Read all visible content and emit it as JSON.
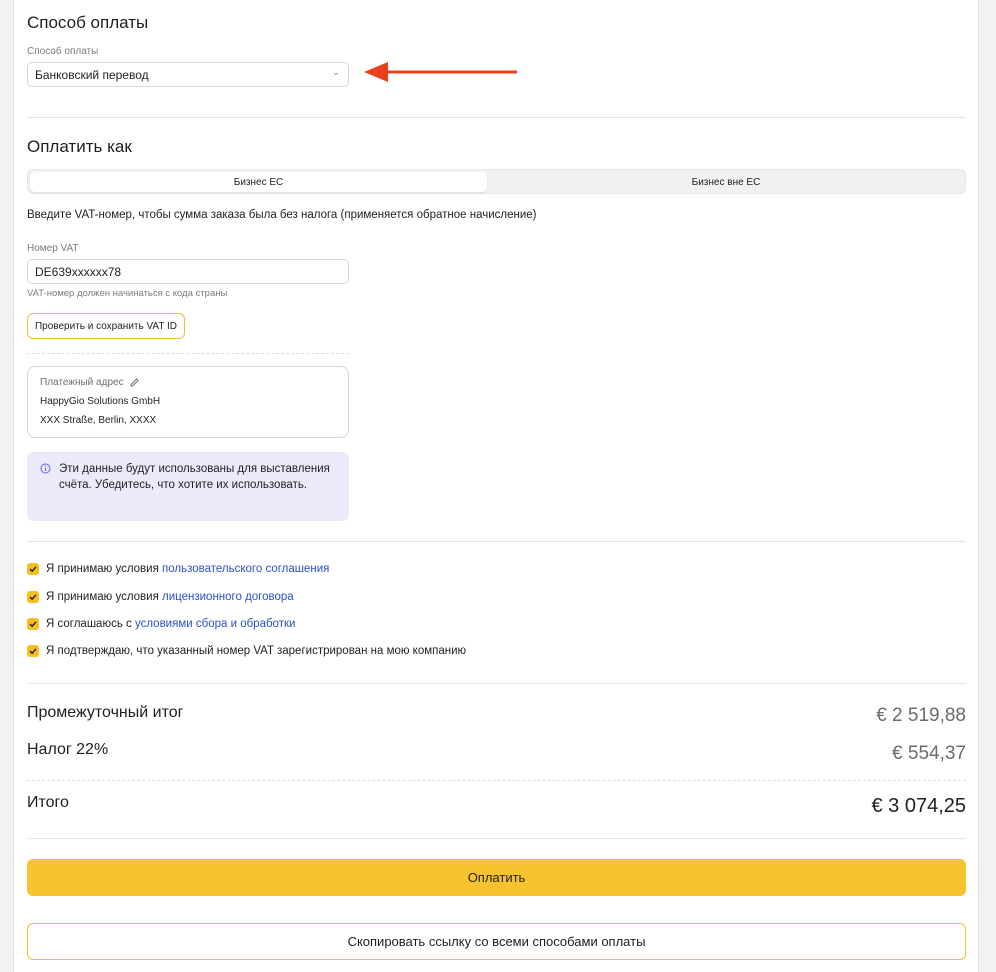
{
  "payment_method": {
    "title": "Способ оплаты",
    "field_label": "Способ оплаты",
    "selected": "Банковский перевод"
  },
  "pay_as": {
    "title": "Оплатить как",
    "tabs": [
      {
        "label": "Бизнес ЕС",
        "active": true
      },
      {
        "label": "Бизнес вне ЕС",
        "active": false
      }
    ],
    "description": "Введите VAT-номер, чтобы сумма заказа была без налога (применяется обратное начисление)",
    "vat_label": "Номер VAT",
    "vat_value": "DE639xxxxxx78",
    "vat_hint": "VAT-номер должен начинаться с кода страны",
    "verify_button": "Проверить и сохранить VAT ID"
  },
  "billing": {
    "label": "Платежный адрес",
    "line1": "HappyGio Solutions GmbH",
    "line2": "XXX Straße, Berlin, XXXX"
  },
  "info_note": "Эти данные будут использованы для выставления счёта. Убедитесь, что хотите их использовать.",
  "agreements": [
    {
      "prefix": "Я принимаю условия ",
      "link": "пользовательского соглашения",
      "checked": true
    },
    {
      "prefix": "Я принимаю условия ",
      "link": "лицензионного договора",
      "checked": true
    },
    {
      "prefix": "Я соглашаюсь с ",
      "link": "условиями сбора и обработки",
      "checked": true
    },
    {
      "prefix": "Я подтверждаю, что указанный номер VAT зарегистрирован на мою компанию",
      "link": "",
      "checked": true
    }
  ],
  "summary": {
    "subtotal_label": "Промежуточный итог",
    "subtotal_value": "€ 2 519,88",
    "tax_label": "Налог 22%",
    "tax_value": "€ 554,37",
    "total_label": "Итого",
    "total_value": "€ 3 074,25"
  },
  "buttons": {
    "pay": "Оплатить",
    "copy_link": "Скопировать ссылку со всеми способами оплаты"
  },
  "colors": {
    "accent_yellow": "#F7C430",
    "link_blue": "#2A4FD1",
    "annotation_arrow": "#E8401C",
    "info_bg": "#EBEAFB"
  }
}
